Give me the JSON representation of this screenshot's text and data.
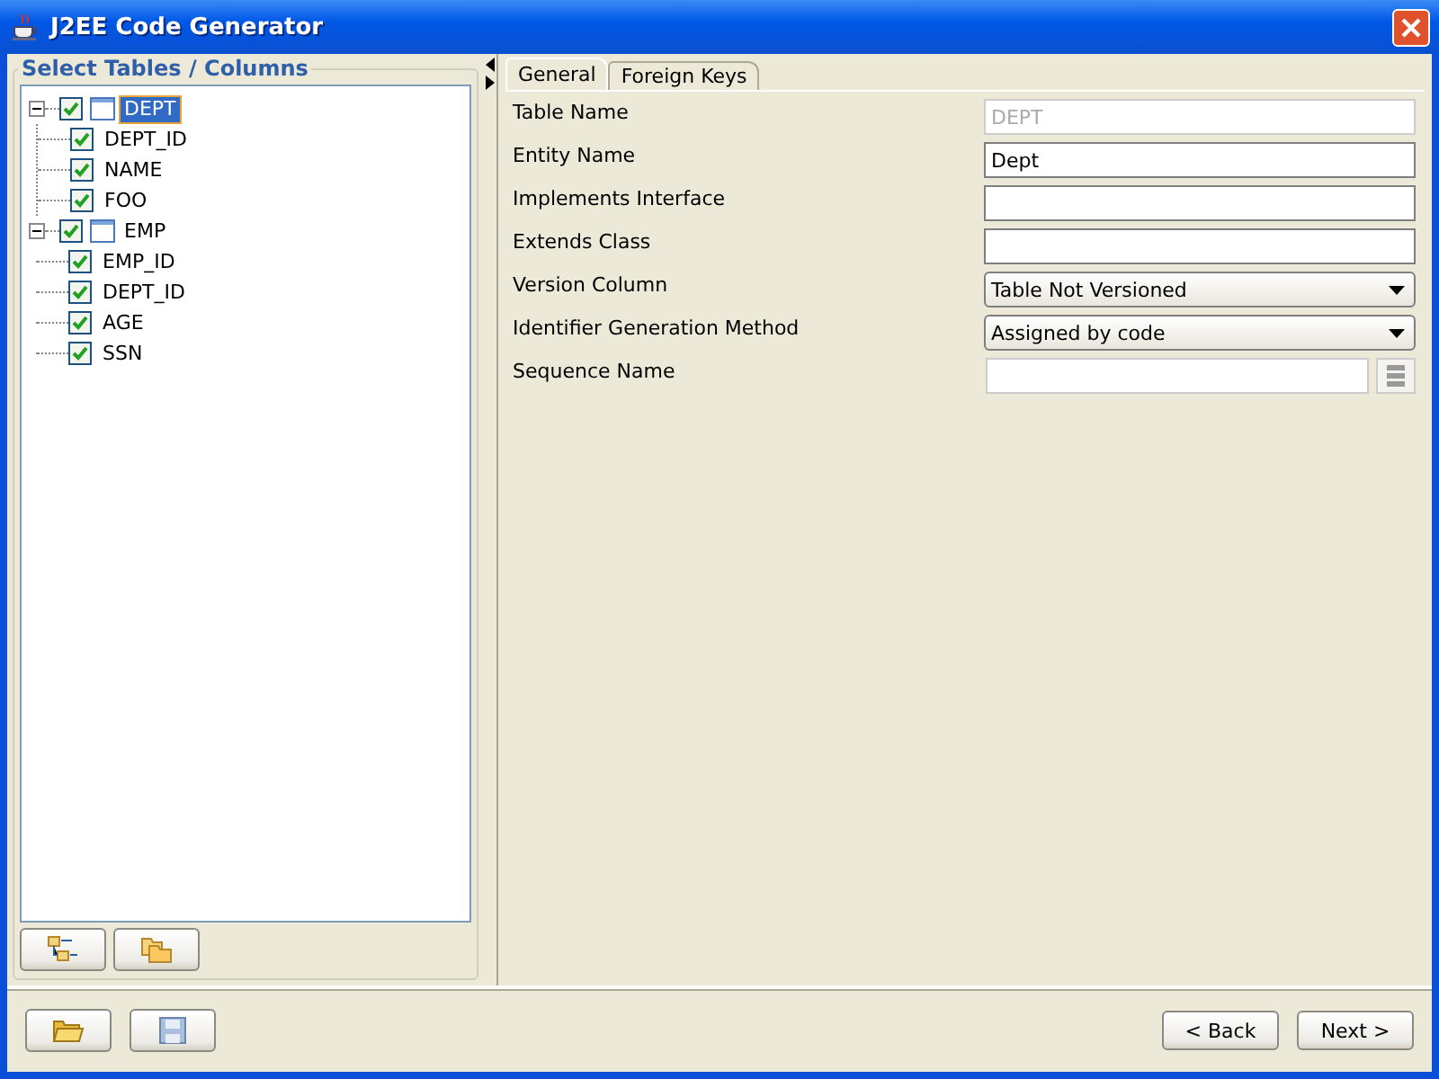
{
  "window": {
    "title": "J2EE Code Generator"
  },
  "tree_panel": {
    "title": "Select Tables / Columns",
    "nodes": [
      {
        "label": "DEPT",
        "checked": true,
        "expanded": true,
        "selected": true,
        "children": [
          {
            "label": "DEPT_ID",
            "checked": true,
            "selected": false
          },
          {
            "label": "NAME",
            "checked": true,
            "selected": false
          },
          {
            "label": "FOO",
            "checked": true,
            "selected": false
          }
        ]
      },
      {
        "label": "EMP",
        "checked": true,
        "expanded": true,
        "selected": false,
        "children": [
          {
            "label": "EMP_ID",
            "checked": true,
            "selected": false
          },
          {
            "label": "DEPT_ID",
            "checked": true,
            "selected": false
          },
          {
            "label": "AGE",
            "checked": true,
            "selected": false
          },
          {
            "label": "SSN",
            "checked": true,
            "selected": false
          }
        ]
      }
    ]
  },
  "tabs": [
    {
      "label": "General",
      "selected": true
    },
    {
      "label": "Foreign Keys",
      "selected": false
    }
  ],
  "fields": [
    {
      "label": "Table Name",
      "kind": "text",
      "value": "DEPT",
      "disabled": true
    },
    {
      "label": "Entity Name",
      "kind": "text",
      "value": "Dept",
      "disabled": false
    },
    {
      "label": "Implements Interface",
      "kind": "text",
      "disabled": false
    },
    {
      "label": "Extends Class",
      "kind": "text",
      "disabled": false
    },
    {
      "label": "Version Column",
      "kind": "select",
      "value": "Table Not Versioned",
      "disabled": false
    },
    {
      "label": "Identifier Generation Method",
      "kind": "select",
      "value": "Assigned by code",
      "disabled": false
    },
    {
      "label": "Sequence Name",
      "kind": "picker",
      "disabled": true
    }
  ],
  "nav_buttons": [
    {
      "label": "< Back"
    },
    {
      "label": "Next >"
    }
  ]
}
